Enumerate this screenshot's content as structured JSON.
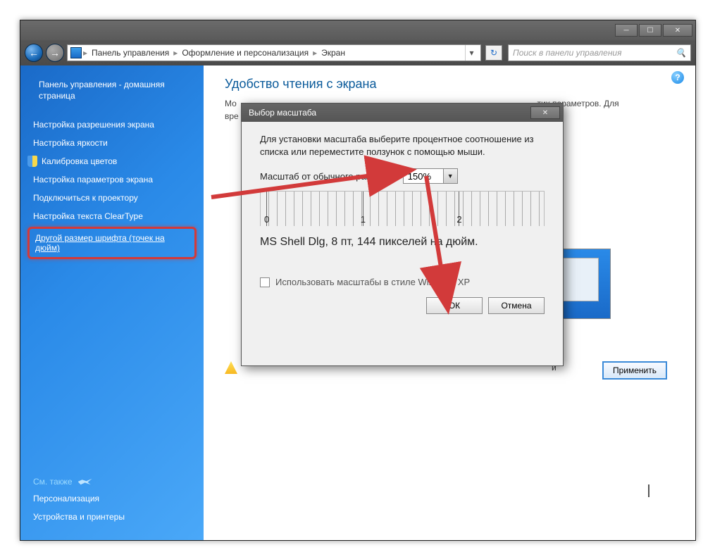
{
  "breadcrumb": {
    "item1": "Панель управления",
    "item2": "Оформление и персонализация",
    "item3": "Экран"
  },
  "search": {
    "placeholder": "Поиск в панели управления"
  },
  "sidebar": {
    "home": "Панель управления - домашняя страница",
    "items": [
      "Настройка разрешения экрана",
      "Настройка яркости",
      "Калибровка цветов",
      "Настройка параметров экрана",
      "Подключиться к проектору",
      "Настройка текста ClearType"
    ],
    "highlighted": "Другой размер шрифта (точек на дюйм)",
    "see_also": "См. также",
    "footer": [
      "Персонализация",
      "Устройства и принтеры"
    ]
  },
  "main": {
    "heading": "Удобство чтения с экрана",
    "line1_pre": "Мо",
    "line1_post": "тих параметров. Для",
    "line2": "вре",
    "line3_post": "й",
    "apply": "Применить"
  },
  "dialog": {
    "title": "Выбор масштаба",
    "instruction": "Для установки масштаба выберите процентное соотношение из списка или переместите ползунок с помощью мыши.",
    "scale_label": "Масштаб от обычного размера:",
    "scale_value": "150%",
    "ruler_ticks": [
      "0",
      "1",
      "2"
    ],
    "sample_text": "MS Shell Dlg, 8 пт, 144 пикселей на дюйм.",
    "checkbox_label": "Использовать масштабы в стиле Windows XP",
    "ok": "ОК",
    "cancel": "Отмена"
  }
}
